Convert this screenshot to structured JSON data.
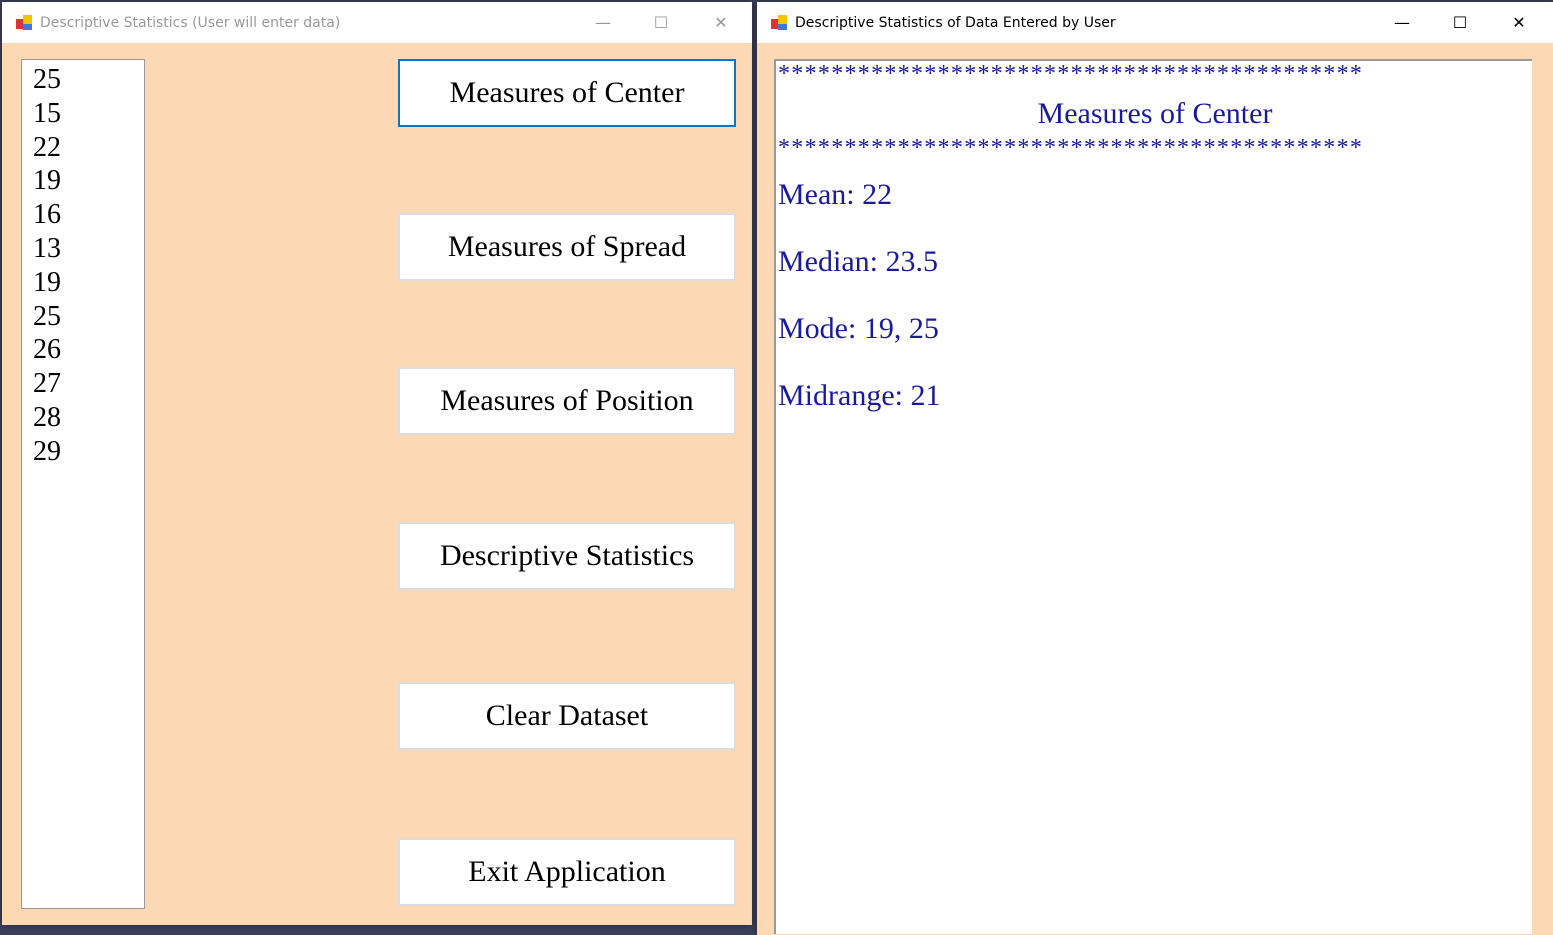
{
  "input_window": {
    "title": "Descriptive Statistics (User will enter data)",
    "data_list": [
      "25",
      "15",
      "22",
      "19",
      "16",
      "13",
      "19",
      "25",
      "26",
      "27",
      "28",
      "29"
    ],
    "buttons": {
      "center": "Measures of Center",
      "spread": "Measures of Spread",
      "position": "Measures of Position",
      "descriptive": "Descriptive Statistics",
      "clear": "Clear Dataset",
      "exit": "Exit Application"
    }
  },
  "output_window": {
    "title": "Descriptive Statistics of Data Entered by User",
    "stars": "********************************************",
    "heading": "Measures of Center",
    "lines": [
      "Mean: 22",
      "Median: 23.5",
      "Mode: 19, 25",
      "Midrange: 21"
    ]
  },
  "colors": {
    "form_background": "#fdd8b5",
    "output_text": "#1a1a9c",
    "focus_border": "#0078d7"
  }
}
